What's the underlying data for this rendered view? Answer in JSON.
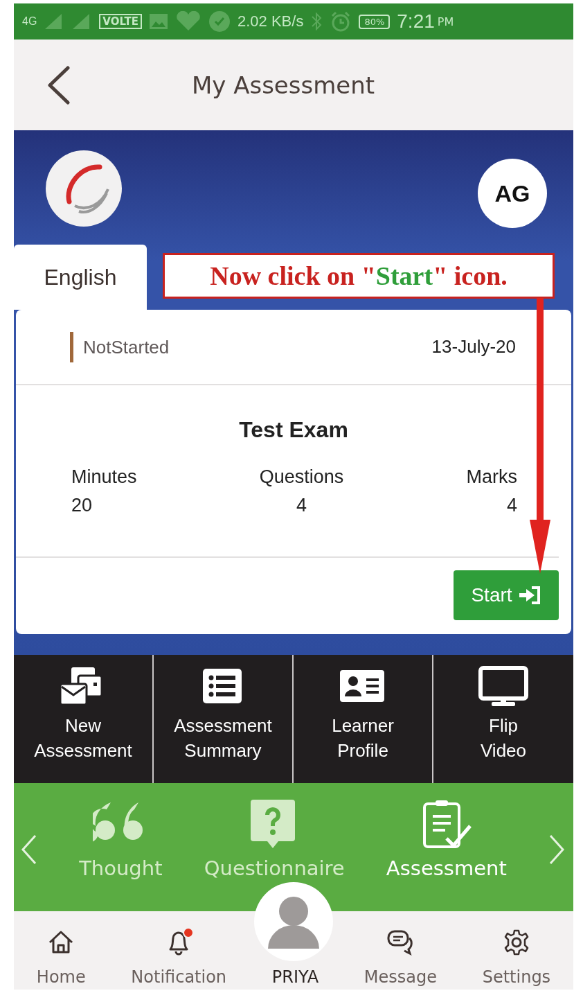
{
  "status_bar": {
    "network": "4G",
    "volte": "VOLTE",
    "speed": "2.02 KB/s",
    "battery": "80%",
    "time": "7:21",
    "ampm": "PM"
  },
  "header": {
    "title": "My Assessment"
  },
  "banner": {
    "avatar_initials": "AG"
  },
  "tabs": [
    {
      "label": "English",
      "selected": true
    }
  ],
  "annotation": {
    "before": "Now click on \"",
    "highlight": "Start",
    "after": "\" icon."
  },
  "assessment": {
    "status": "NotStarted",
    "date": "13-July-20",
    "title": "Test Exam",
    "stats": [
      {
        "label": "Minutes",
        "value": "20"
      },
      {
        "label": "Questions",
        "value": "4"
      },
      {
        "label": "Marks",
        "value": "4"
      }
    ],
    "start_button": "Start"
  },
  "tiles": [
    {
      "kind": "new",
      "line1": "New",
      "line2": "Assessment"
    },
    {
      "kind": "summary",
      "line1": "Assessment",
      "line2": "Summary"
    },
    {
      "kind": "profile",
      "line1": "Learner",
      "line2": "Profile"
    },
    {
      "kind": "video",
      "line1": "Flip",
      "line2": "Video"
    }
  ],
  "carousel": [
    {
      "kind": "thought",
      "label": "Thought",
      "selected": false
    },
    {
      "kind": "questionnaire",
      "label": "Questionnaire",
      "selected": false
    },
    {
      "kind": "assessment",
      "label": "Assessment",
      "selected": true
    }
  ],
  "bottom_nav": [
    {
      "kind": "home",
      "label": "Home",
      "selected": false,
      "badge": false
    },
    {
      "kind": "notification",
      "label": "Notification",
      "selected": false,
      "badge": true
    },
    {
      "kind": "profile",
      "label": "PRIYA",
      "selected": true,
      "badge": false
    },
    {
      "kind": "message",
      "label": "Message",
      "selected": false,
      "badge": false
    },
    {
      "kind": "settings",
      "label": "Settings",
      "selected": false,
      "badge": false
    }
  ]
}
